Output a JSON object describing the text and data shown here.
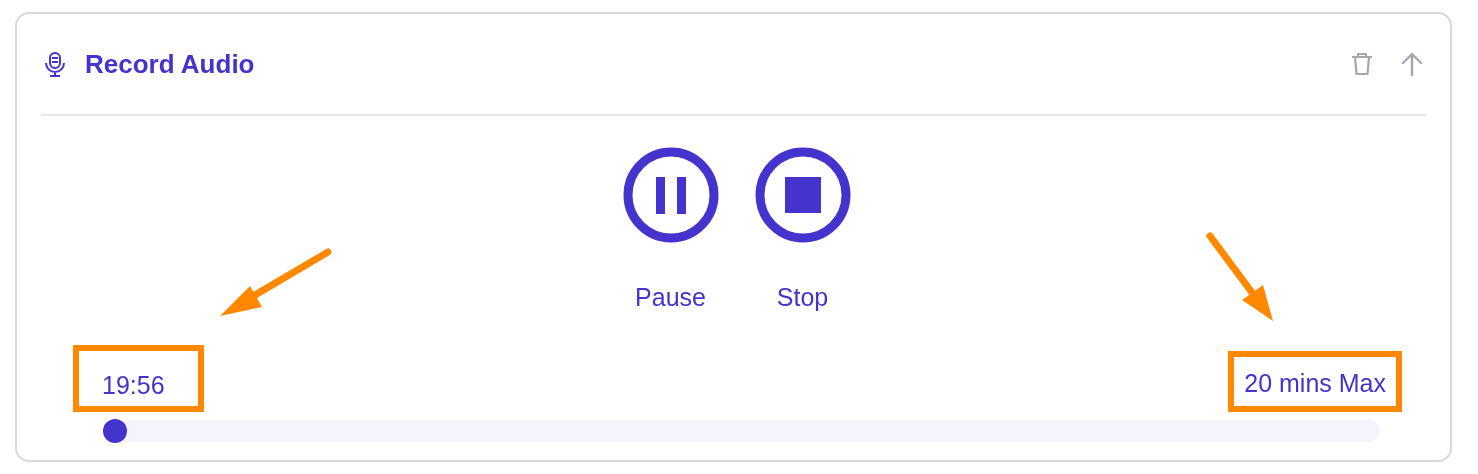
{
  "panel": {
    "title": "Record Audio"
  },
  "controls": [
    {
      "kind": "pause",
      "label": "Pause"
    },
    {
      "kind": "stop",
      "label": "Stop"
    }
  ],
  "progress": {
    "elapsed": "19:56",
    "max": "20 mins Max",
    "level": 0,
    "highlighted": true
  }
}
